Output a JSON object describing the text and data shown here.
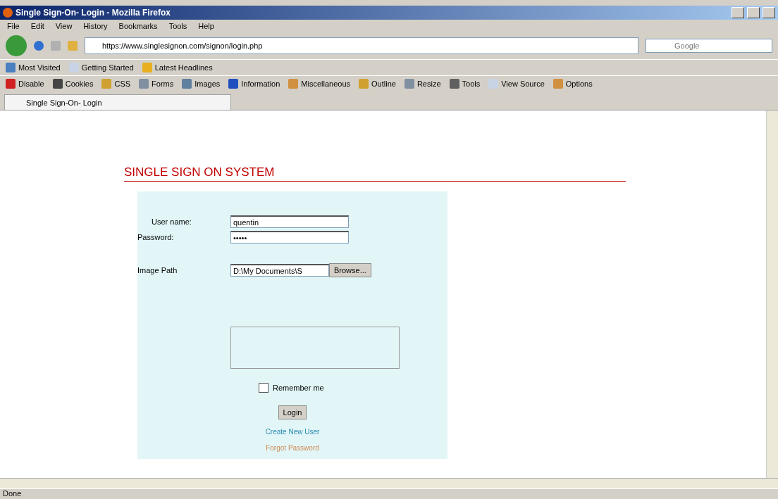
{
  "window": {
    "title": "Single Sign-On- Login - Mozilla Firefox"
  },
  "menu": [
    "File",
    "Edit",
    "View",
    "History",
    "Bookmarks",
    "Tools",
    "Help"
  ],
  "address": {
    "url": "https://www.singlesignon.com/signon/login.php"
  },
  "search": {
    "placeholder": "Google"
  },
  "bookmarks": [
    "Most Visited",
    "Getting Started",
    "Latest Headlines"
  ],
  "dev_toolbar": [
    "Disable",
    "Cookies",
    "CSS",
    "Forms",
    "Images",
    "Information",
    "Miscellaneous",
    "Outline",
    "Resize",
    "Tools",
    "View Source",
    "Options"
  ],
  "tabs": [
    {
      "label": "Single Sign-On- Login",
      "selected": true
    }
  ],
  "page": {
    "heading": "SINGLE SIGN ON SYSTEM",
    "fields": [
      {
        "kind": "text",
        "label": "User name:",
        "value": "quentin"
      },
      {
        "kind": "password",
        "label": "Password:",
        "value": "•••••"
      },
      {
        "kind": "file",
        "label": "Image Path",
        "value": "D:\\My Documents\\S",
        "button": "Browse..."
      }
    ],
    "remember": {
      "label": "Remember me",
      "checked": false
    },
    "login": "Login",
    "links": [
      {
        "label": "Create New User",
        "color": "#2a8ab0"
      },
      {
        "label": "Forgot Password",
        "color": "#d08a50"
      }
    ]
  },
  "status_bar": "Done"
}
